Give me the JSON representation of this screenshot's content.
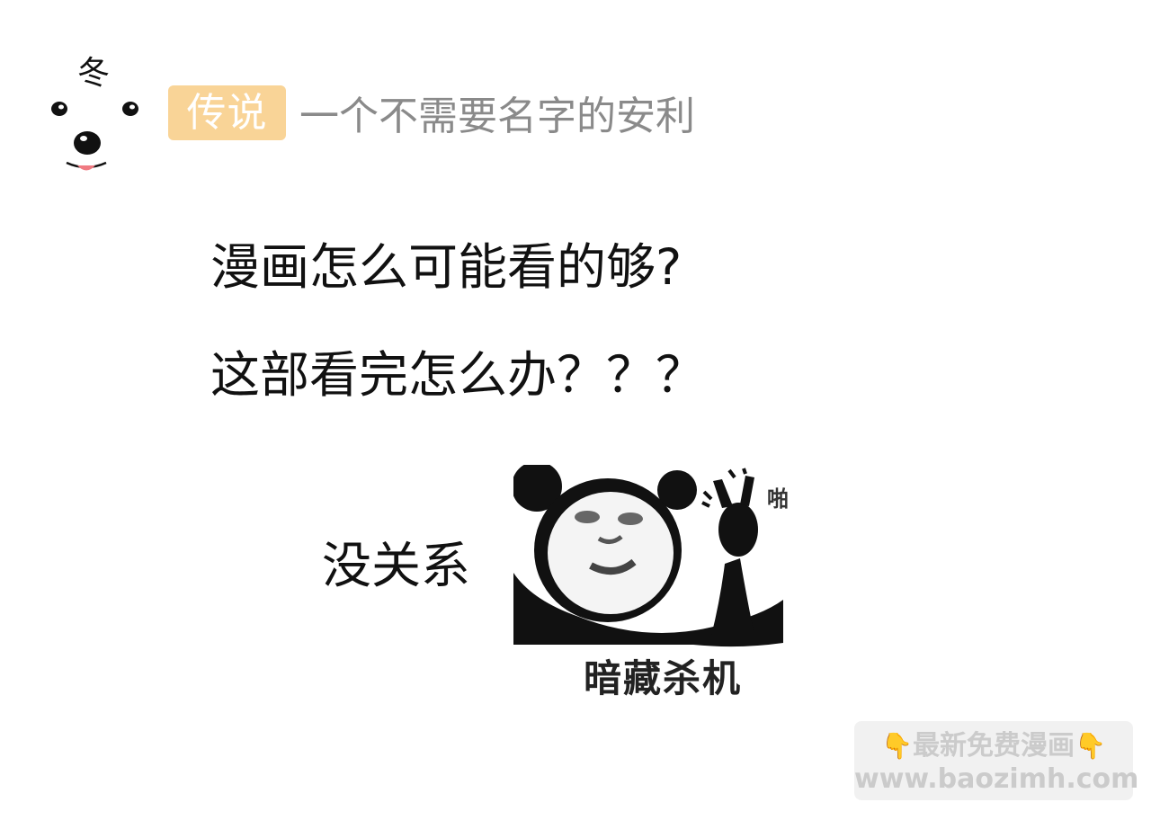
{
  "header": {
    "logo_char": "冬",
    "tag": "传说",
    "tagline": "一个不需要名字的安利"
  },
  "content": {
    "line1": "漫画怎么可能看的够?",
    "line2": "这部看完怎么办？？？",
    "reply": "没关系"
  },
  "meme": {
    "caption": "暗藏杀机",
    "sfx": "啪"
  },
  "watermark": {
    "left_icon": "pointing-down-icon",
    "line1": "最新免费漫画",
    "right_icon": "pointing-down-icon",
    "line2": "www.baozimh.com"
  },
  "colors": {
    "badge_bg": "#f9d497",
    "tagline_text": "#8a8a8a",
    "body_text": "#111111"
  }
}
